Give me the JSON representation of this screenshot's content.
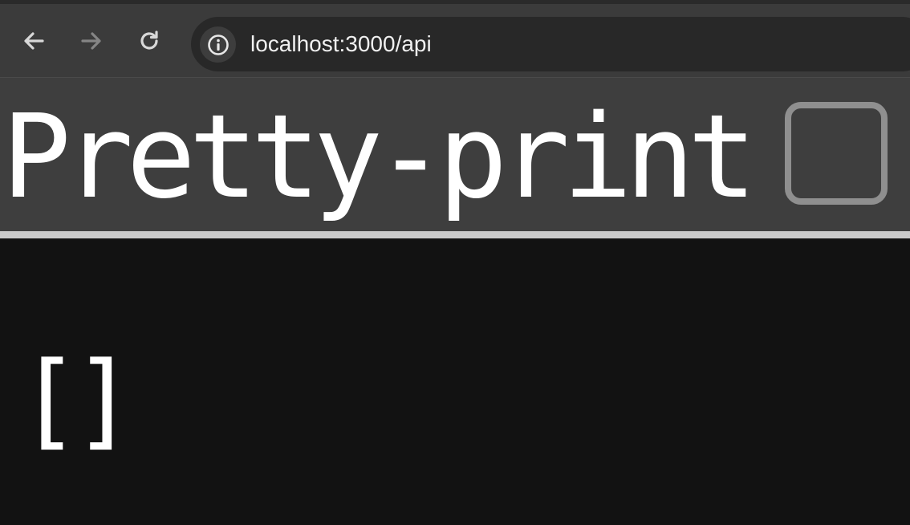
{
  "browser": {
    "url": "localhost:3000/api",
    "icons": {
      "back": "arrow-left-icon",
      "forward": "arrow-right-icon",
      "reload": "reload-icon",
      "site_info": "info-icon"
    }
  },
  "pretty_print": {
    "label": "Pretty-print",
    "checked": false
  },
  "content": {
    "json": "[]"
  },
  "colors": {
    "toolbar": "#3b3b3b",
    "omnibox": "#282828",
    "pretty_print_bar": "#3e3e3e",
    "page_background": "#121212",
    "text": "#ffffff"
  }
}
